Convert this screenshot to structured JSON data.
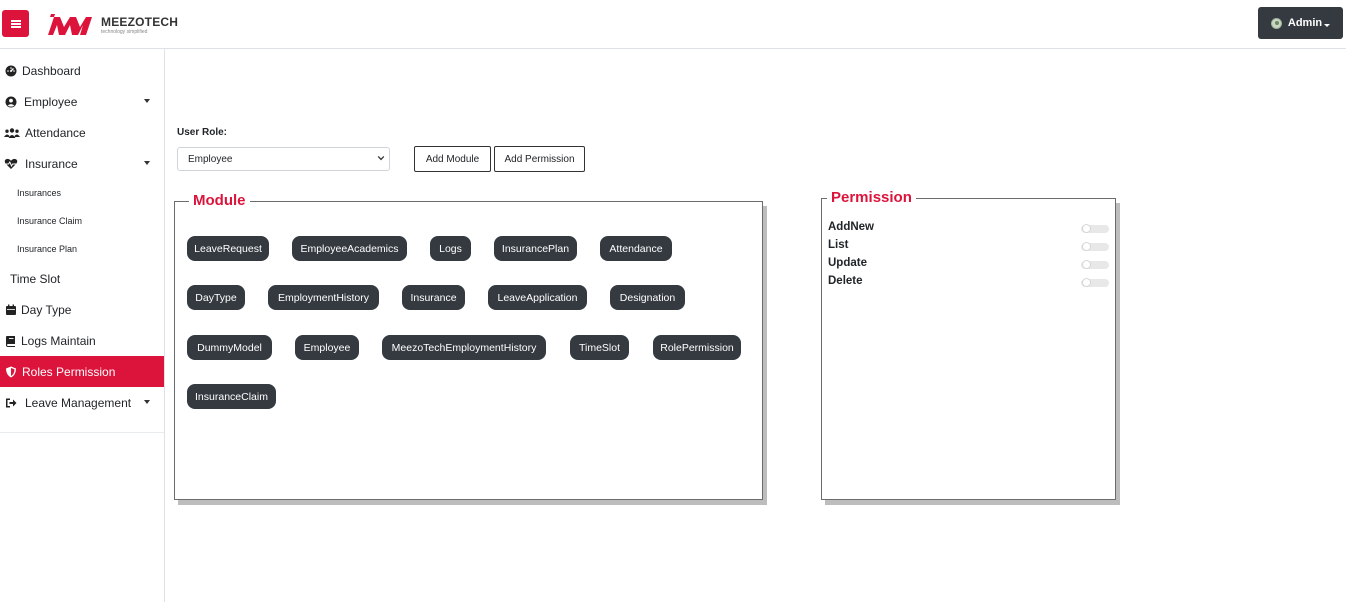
{
  "header": {
    "brand_name": "MEEZOTECH",
    "brand_tagline": "technology simplified",
    "user_label": "Admin"
  },
  "sidebar": {
    "items": [
      {
        "label": "Dashboard",
        "icon": "dashboard-icon"
      },
      {
        "label": "Employee",
        "icon": "user-circle-icon",
        "expandable": true
      },
      {
        "label": "Attendance",
        "icon": "users-icon"
      },
      {
        "label": "Insurance",
        "icon": "heartbeat-icon",
        "expandable": true
      },
      {
        "label": "Insurances",
        "sub": true
      },
      {
        "label": "Insurance Claim",
        "sub": true
      },
      {
        "label": "Insurance Plan",
        "sub": true
      },
      {
        "label": "Time Slot"
      },
      {
        "label": "Day Type",
        "icon": "calendar-icon"
      },
      {
        "label": "Logs Maintain",
        "icon": "book-icon"
      },
      {
        "label": "Roles Permission",
        "icon": "shield-icon",
        "active": true
      },
      {
        "label": "Leave Management",
        "icon": "sign-out-icon",
        "expandable": true
      }
    ]
  },
  "form": {
    "role_label": "User Role:",
    "role_value": "Employee",
    "add_module_label": "Add Module",
    "add_permission_label": "Add Permission"
  },
  "module_panel": {
    "title": "Module",
    "modules": [
      "LeaveRequest",
      "EmployeeAcademics",
      "Logs",
      "InsurancePlan",
      "Attendance",
      "DayType",
      "EmploymentHistory",
      "Insurance",
      "LeaveApplication",
      "Designation",
      "DummyModel",
      "Employee",
      "MeezoTechEmploymentHistory",
      "TimeSlot",
      "RolePermission",
      "InsuranceClaim"
    ]
  },
  "permission_panel": {
    "title": "Permission",
    "permissions": [
      {
        "label": "AddNew",
        "enabled": false
      },
      {
        "label": "List",
        "enabled": false
      },
      {
        "label": "Update",
        "enabled": false
      },
      {
        "label": "Delete",
        "enabled": false
      }
    ]
  },
  "colors": {
    "accent": "#dc143c",
    "dark": "#343a40"
  }
}
